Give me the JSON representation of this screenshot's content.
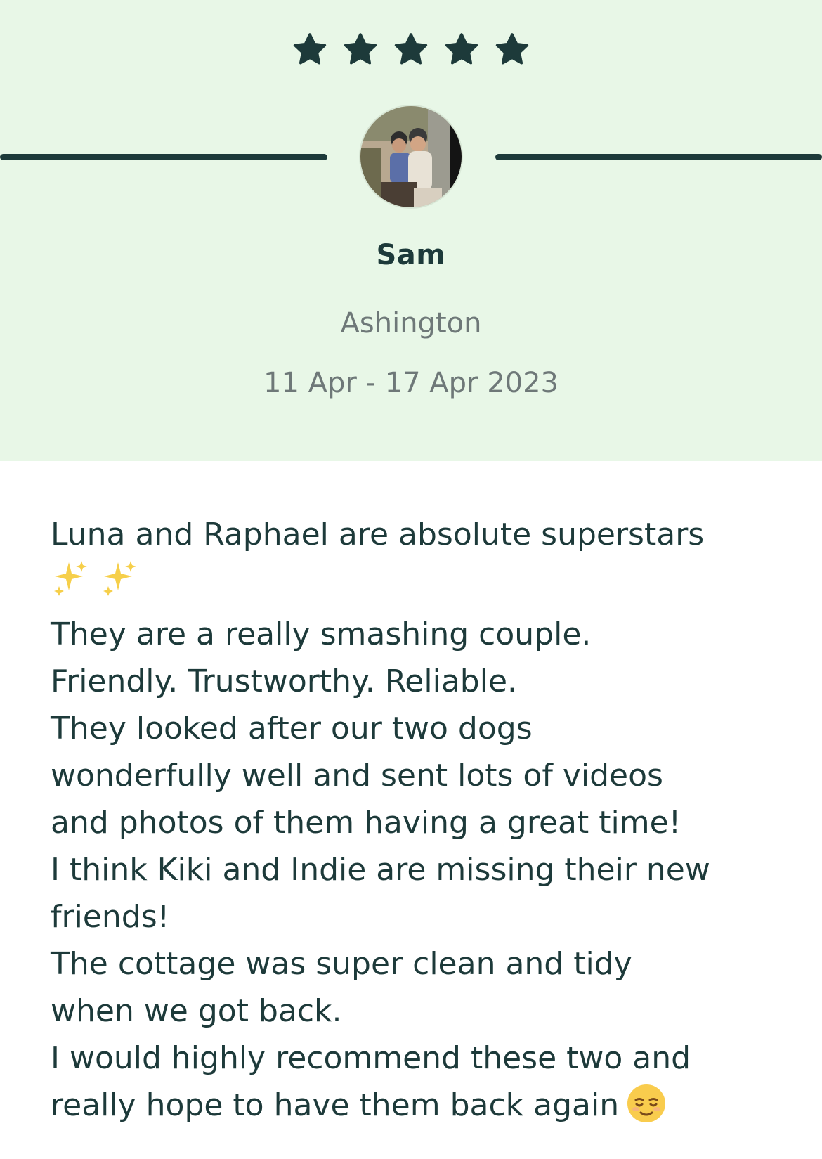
{
  "rating": {
    "value": 5,
    "max": 5,
    "star_color": "#1d3a3a"
  },
  "reviewer": {
    "name": "Sam",
    "location": "Ashington",
    "dates": "11 Apr - 17 Apr 2023"
  },
  "review": {
    "lines": [
      "Luna and Raphael are absolute superstars",
      "",
      "They are a really smashing couple.",
      "Friendly. Trustworthy. Reliable.",
      "They looked after our two dogs",
      "wonderfully well and sent lots of videos",
      "and photos of them having a great time!",
      "I think Kiki and Indie are missing their new",
      "friends!",
      "The cottage was super clean and tidy",
      "when we got back.",
      "I would highly recommend these two and",
      "really hope to have them back again"
    ],
    "sparkle_icon": "sparkles-emoji",
    "end_icon": "relieved-face-emoji"
  },
  "colors": {
    "header_background": "#e8f7e7",
    "text_primary": "#1d3a3a",
    "text_secondary": "#6e7878"
  }
}
